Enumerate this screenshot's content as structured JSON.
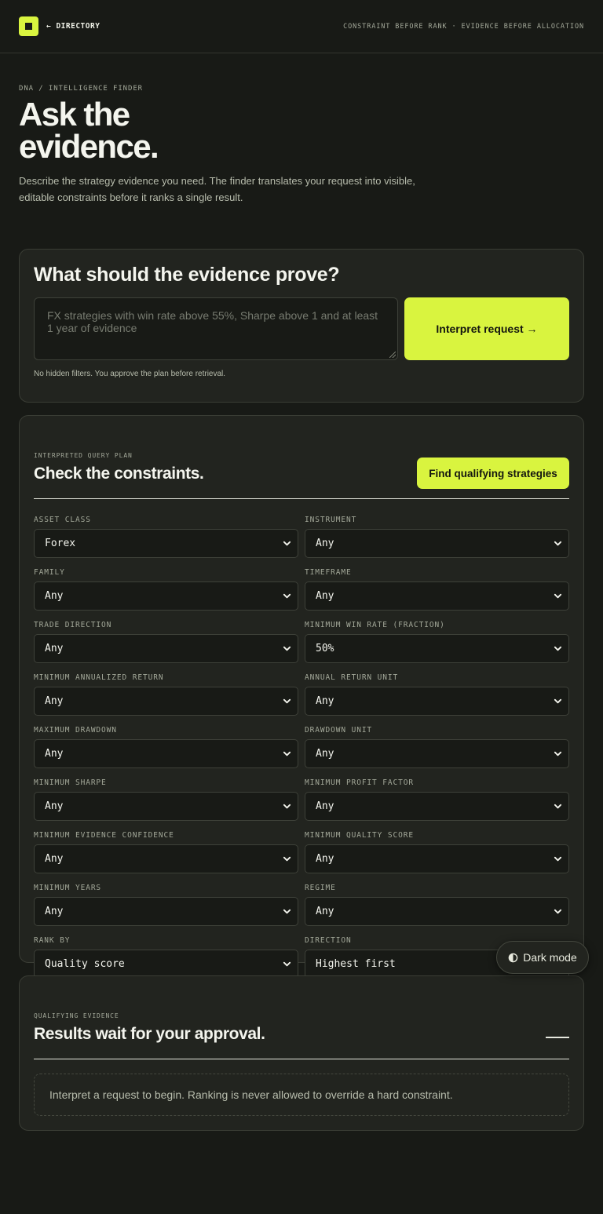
{
  "header": {
    "back_label": "← DIRECTORY",
    "tagline": "CONSTRAINT BEFORE RANK · EVIDENCE BEFORE ALLOCATION"
  },
  "hero": {
    "breadcrumb": "DNA / INTELLIGENCE FINDER",
    "title": "Ask the evidence.",
    "description": "Describe the strategy evidence you need. The finder translates your request into visible, editable constraints before it ranks a single result."
  },
  "query": {
    "title": "What should the evidence prove?",
    "value": "",
    "placeholder": "FX strategies with win rate above 55%, Sharpe above 1 and at least 1 year of evidence",
    "submit_label": "Interpret request →",
    "note": "No hidden filters. You approve the plan before retrieval."
  },
  "plan": {
    "eyebrow": "INTERPRETED QUERY PLAN",
    "title": "Check the constraints.",
    "find_label": "Find qualifying strategies",
    "fields": [
      {
        "label": "ASSET CLASS",
        "value": "Forex"
      },
      {
        "label": "INSTRUMENT",
        "value": "Any"
      },
      {
        "label": "FAMILY",
        "value": "Any"
      },
      {
        "label": "TIMEFRAME",
        "value": "Any"
      },
      {
        "label": "TRADE DIRECTION",
        "value": "Any"
      },
      {
        "label": "MINIMUM WIN RATE (FRACTION)",
        "value": "50%"
      },
      {
        "label": "MINIMUM ANNUALIZED RETURN",
        "value": "Any"
      },
      {
        "label": "ANNUAL RETURN UNIT",
        "value": "Any"
      },
      {
        "label": "MAXIMUM DRAWDOWN",
        "value": "Any"
      },
      {
        "label": "DRAWDOWN UNIT",
        "value": "Any"
      },
      {
        "label": "MINIMUM SHARPE",
        "value": "Any"
      },
      {
        "label": "MINIMUM PROFIT FACTOR",
        "value": "Any"
      },
      {
        "label": "MINIMUM EVIDENCE CONFIDENCE",
        "value": "Any"
      },
      {
        "label": "MINIMUM QUALITY SCORE",
        "value": "Any"
      },
      {
        "label": "MINIMUM YEARS",
        "value": "Any"
      },
      {
        "label": "REGIME",
        "value": "Any"
      },
      {
        "label": "RANK BY",
        "value": "Quality score"
      },
      {
        "label": "DIRECTION",
        "value": "Highest first"
      }
    ]
  },
  "results": {
    "eyebrow": "QUALIFYING EVIDENCE",
    "title": "Results wait for your approval.",
    "empty_message": "Interpret a request to begin. Ranking is never allowed to override a hard constraint."
  },
  "theme_toggle": {
    "label": "Dark mode",
    "icon": "half-circle-icon"
  },
  "colors": {
    "accent": "#d9f43f",
    "background": "#181a16",
    "panel": "#22241f"
  }
}
